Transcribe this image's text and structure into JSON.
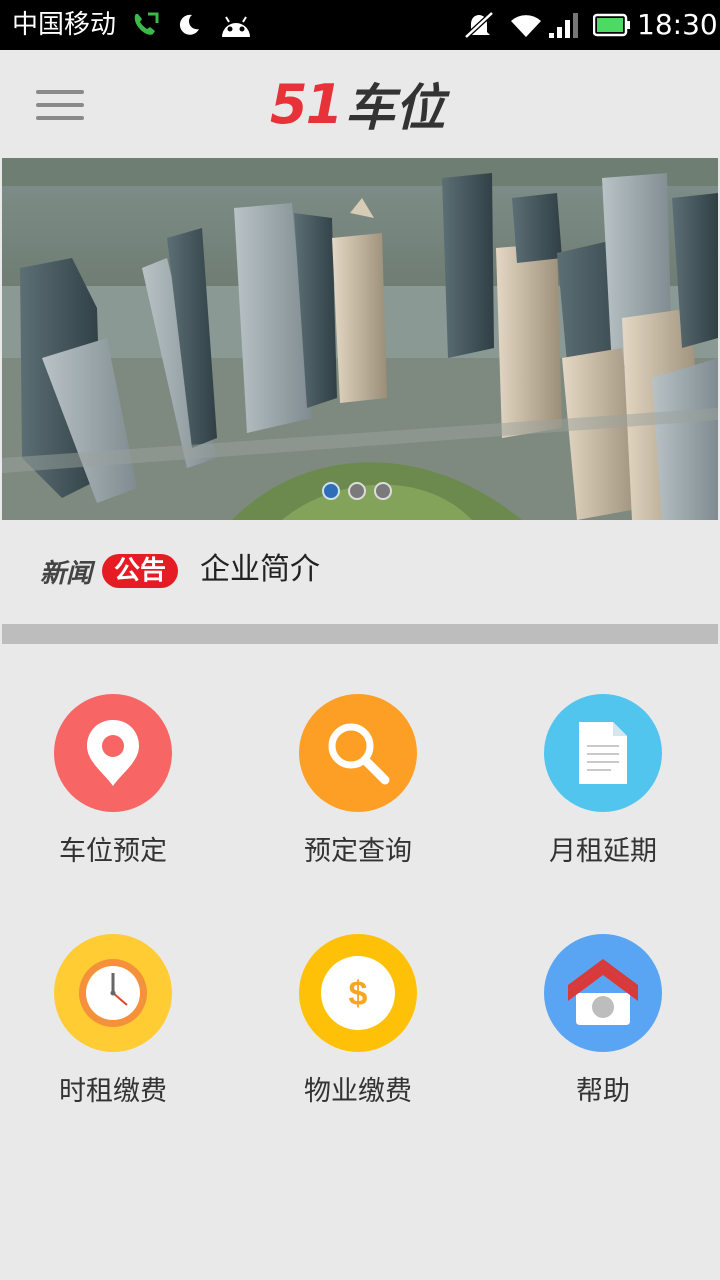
{
  "status_bar": {
    "carrier": "中国移动",
    "time": "18:30",
    "icons": [
      "phone-call-icon",
      "moon-icon",
      "android-icon",
      "mute-icon",
      "wifi-icon",
      "signal-icon",
      "battery-icon"
    ]
  },
  "header": {
    "brand_number": "51",
    "brand_text": "车位",
    "menu_icon": "hamburger-menu-icon"
  },
  "banner": {
    "image": "city-skyline-photo",
    "slides": 3,
    "active_slide": 1
  },
  "news": {
    "label": "新闻",
    "badge": "公告",
    "headline": "企业简介"
  },
  "menu": {
    "items": [
      {
        "label": "车位预定",
        "icon": "location-pin-icon",
        "color": "#f76565"
      },
      {
        "label": "预定查询",
        "icon": "search-icon",
        "color": "#fd9f25"
      },
      {
        "label": "月租延期",
        "icon": "document-icon",
        "color": "#51c5ee"
      },
      {
        "label": "时租缴费",
        "icon": "clock-icon",
        "color": "#ffcc33"
      },
      {
        "label": "物业缴费",
        "icon": "dollar-icon",
        "color": "#ffc107"
      },
      {
        "label": "帮助",
        "icon": "home-icon",
        "color": "#5aa4f4"
      }
    ]
  }
}
